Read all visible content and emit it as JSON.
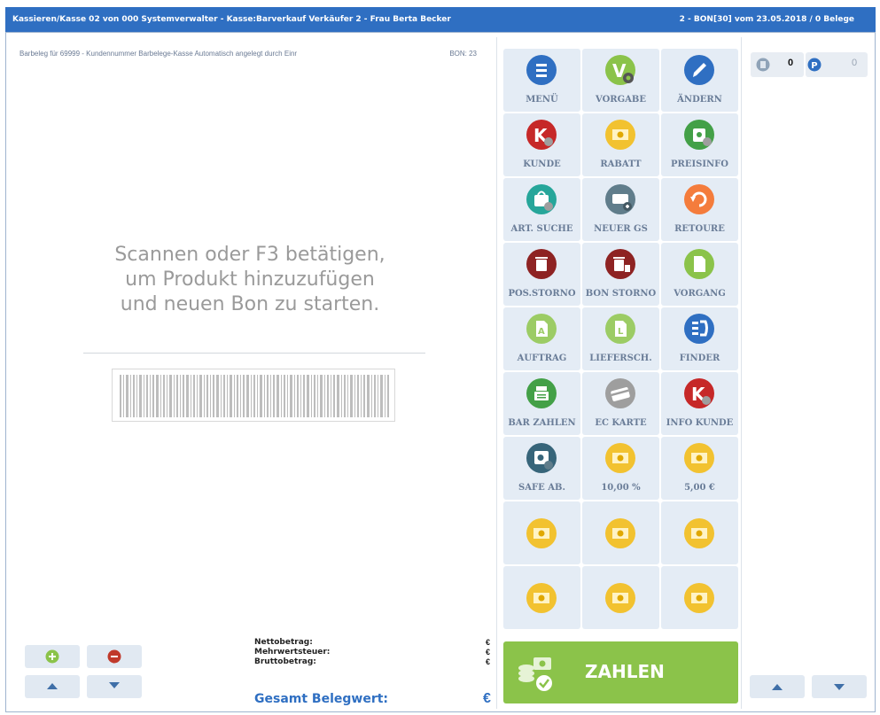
{
  "window": {
    "title_left": "Kassieren/Kasse 02 von 000 Systemverwalter - Kasse:Barverkauf Verkäufer 2 - Frau Berta Becker",
    "title_right": "2 - BON[30] vom 23.05.2018 / 0 Belege"
  },
  "receipt": {
    "description": "Barbeleg für 69999 - Kundennummer Barbelege-Kasse Automatisch angelegt durch Einr",
    "bon": "BON: 23",
    "prompt_lines": [
      "Scannen oder F3 betätigen,",
      "um Produkt hinzuzufügen",
      "und neuen Bon zu starten."
    ]
  },
  "totals": {
    "net_label": "Nettobetrag:",
    "tax_label": "Mehrwertsteuer:",
    "gross_label": "Bruttobetrag:",
    "net_currency": "€",
    "tax_currency": "€",
    "gross_currency": "€",
    "grand_label": "Gesamt Belegwert:",
    "grand_currency": "€"
  },
  "counters": {
    "left_value": "0",
    "right_value": "0"
  },
  "tiles": [
    {
      "label": "MENÜ",
      "icon": "menu-icon",
      "color": "#2f6fc2"
    },
    {
      "label": "VORGABE",
      "icon": "settings-v-icon",
      "color": "#8bc34a"
    },
    {
      "label": "ÄNDERN",
      "icon": "pencil-icon",
      "color": "#2f6fc2"
    },
    {
      "label": "KUNDE",
      "icon": "customer-k-icon",
      "color": "#c62828"
    },
    {
      "label": "RABATT",
      "icon": "money-icon",
      "color": "#f2c230"
    },
    {
      "label": "PREISINFO",
      "icon": "price-info-icon",
      "color": "#43a047"
    },
    {
      "label": "ART. SUCHE",
      "icon": "article-search-icon",
      "color": "#26a69a"
    },
    {
      "label": "NEUER GS",
      "icon": "voucher-icon",
      "color": "#607d8b"
    },
    {
      "label": "RETOURE",
      "icon": "return-icon",
      "color": "#f47c3c"
    },
    {
      "label": "POS.STORNO",
      "icon": "trash-icon",
      "color": "#8e2323"
    },
    {
      "label": "BON STORNO",
      "icon": "trash-receipt-icon",
      "color": "#8e2323"
    },
    {
      "label": "VORGANG",
      "icon": "document-icon",
      "color": "#8bc34a"
    },
    {
      "label": "AUFTRAG",
      "icon": "order-document-icon",
      "color": "#9ccc65"
    },
    {
      "label": "LIEFERSCH.",
      "icon": "delivery-document-icon",
      "color": "#9ccc65"
    },
    {
      "label": "FINDER",
      "icon": "finder-icon",
      "color": "#2f6fc2"
    },
    {
      "label": "BAR ZAHLEN",
      "icon": "cash-register-icon",
      "color": "#43a047"
    },
    {
      "label": "EC KARTE",
      "icon": "card-icon",
      "color": "#9e9e9e"
    },
    {
      "label": "INFO KUNDE",
      "icon": "customer-info-icon",
      "color": "#c62828"
    },
    {
      "label": "SAFE AB.",
      "icon": "safe-icon",
      "color": "#37657a"
    },
    {
      "label": "10,00 %",
      "icon": "money-icon",
      "color": "#f2c230"
    },
    {
      "label": "5,00 €",
      "icon": "money-icon",
      "color": "#f2c230"
    },
    {
      "label": "",
      "icon": "money-icon",
      "color": "#f2c230"
    },
    {
      "label": "",
      "icon": "money-icon",
      "color": "#f2c230"
    },
    {
      "label": "",
      "icon": "money-icon",
      "color": "#f2c230"
    },
    {
      "label": "",
      "icon": "money-icon",
      "color": "#f2c230"
    },
    {
      "label": "",
      "icon": "money-icon",
      "color": "#f2c230"
    },
    {
      "label": "",
      "icon": "money-icon",
      "color": "#f2c230"
    }
  ],
  "pay": {
    "label": "ZAHLEN",
    "color": "#8bc34a"
  }
}
